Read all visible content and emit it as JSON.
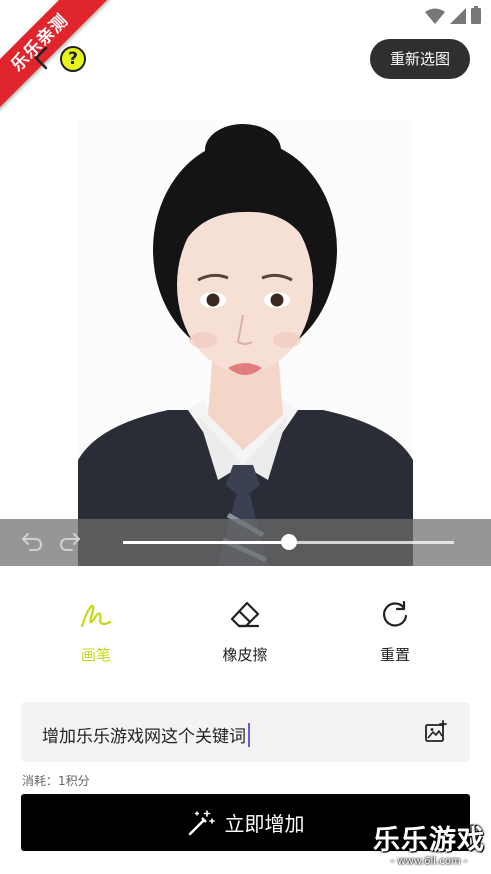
{
  "status_bar": {
    "icons": [
      "wifi-icon",
      "signal-icon",
      "battery-icon"
    ]
  },
  "ribbon": {
    "text": "乐乐亲测",
    "color": "#e0252c"
  },
  "header": {
    "help_symbol": "?",
    "reselect_label": "重新选图"
  },
  "slider": {
    "brush_size_percent": 50
  },
  "tools": [
    {
      "label": "画笔",
      "icon": "brush-icon",
      "active": true
    },
    {
      "label": "橡皮擦",
      "icon": "eraser-icon",
      "active": false
    },
    {
      "label": "重置",
      "icon": "reset-icon",
      "active": false
    }
  ],
  "prompt": {
    "value": "增加乐乐游戏网这个关键词"
  },
  "cost": {
    "text": "消耗：1积分"
  },
  "primary_action": {
    "label": "立即增加"
  },
  "watermark": {
    "title": "乐乐游戏",
    "url": "- www.6ll.com -"
  },
  "colors": {
    "accent": "#c4d81a",
    "help_badge": "#e6f51a",
    "button_dark": "#2f2f2f",
    "primary_button": "#000000"
  }
}
